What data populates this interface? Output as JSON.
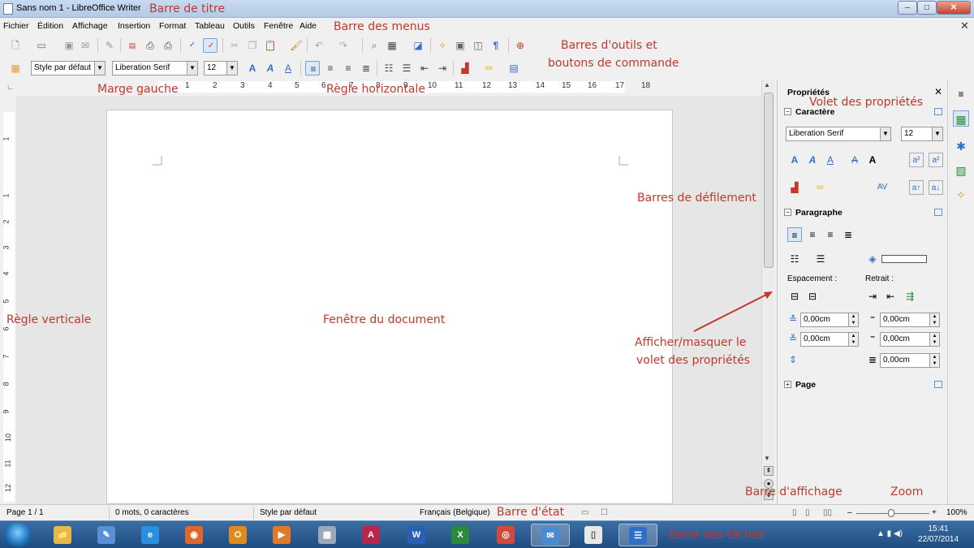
{
  "window": {
    "title": "Sans nom 1 - LibreOffice Writer",
    "min_label": "–",
    "max_label": "□",
    "close_label": "✕"
  },
  "menubar": {
    "items": [
      "Fichier",
      "Édition",
      "Affichage",
      "Insertion",
      "Format",
      "Tableau",
      "Outils",
      "Fenêtre",
      "Aide"
    ],
    "doc_close": "✕"
  },
  "formatting": {
    "style": "Style par défaut",
    "font": "Liberation Serif",
    "size": "12"
  },
  "ruler": {
    "h_numbers": [
      "1",
      "2",
      "3",
      "4",
      "5",
      "6",
      "7",
      "8",
      "9",
      "10",
      "11",
      "12",
      "13",
      "14",
      "15",
      "16",
      "17",
      "18"
    ],
    "v_numbers": [
      "1",
      "1",
      "2",
      "3",
      "4",
      "5",
      "6",
      "7",
      "8",
      "9",
      "10",
      "11",
      "12"
    ]
  },
  "sidebar": {
    "title": "Propriétés",
    "close": "✕",
    "char_section": "Caractère",
    "font": "Liberation Serif",
    "size": "12",
    "para_section": "Paragraphe",
    "spacing_label": "Espacement :",
    "indent_label": "Retrait :",
    "above_value": "0,00cm",
    "below_value": "0,00cm",
    "before_value": "0,00cm",
    "after_value": "0,00cm",
    "first_line_value": "0,00cm",
    "page_section": "Page"
  },
  "statusbar": {
    "page": "Page 1 / 1",
    "words": "0 mots, 0 caractères",
    "style": "Style par défaut",
    "language": "Français (Belgique)",
    "zoom": "100%",
    "zoom_minus": "–",
    "zoom_plus": "+"
  },
  "taskbar": {
    "apps": [
      {
        "icon": "windows-explorer-icon",
        "glyph": "📁",
        "color": "#e8b74a"
      },
      {
        "icon": "tools-icon",
        "glyph": "✎",
        "color": "#5a8fd6"
      },
      {
        "icon": "internet-explorer-icon",
        "glyph": "e",
        "color": "#2a8fe0"
      },
      {
        "icon": "firefox-icon",
        "glyph": "◉",
        "color": "#e0662a"
      },
      {
        "icon": "outlook-icon",
        "glyph": "O",
        "color": "#e08a1e"
      },
      {
        "icon": "media-player-icon",
        "glyph": "▶",
        "color": "#e07a2a"
      },
      {
        "icon": "calculator-icon",
        "glyph": "▦",
        "color": "#9aa8b8"
      },
      {
        "icon": "access-icon",
        "glyph": "A",
        "color": "#b8274a"
      },
      {
        "icon": "word-icon",
        "glyph": "W",
        "color": "#2a5fb8"
      },
      {
        "icon": "excel-icon",
        "glyph": "X",
        "color": "#2a8a3a"
      },
      {
        "icon": "chrome-icon",
        "glyph": "◎",
        "color": "#d44a3a"
      },
      {
        "icon": "thunderbird-icon",
        "glyph": "✉",
        "color": "#4a8ad0"
      },
      {
        "icon": "libreoffice-icon",
        "glyph": "▯",
        "color": "#e8e8e8"
      },
      {
        "icon": "writer-icon",
        "glyph": "☰",
        "color": "#2f6fc8"
      }
    ],
    "time": "15:41",
    "date": "22/07/2014"
  },
  "annotations": {
    "title_bar": "Barre de titre",
    "menu_bar": "Barre des menus",
    "toolbars_1": "Barres d'outils et",
    "toolbars_2": "boutons de commande",
    "left_margin": "Marge gauche",
    "h_ruler": "Règle horizontale",
    "props_pane": "Volet des propriétés",
    "scrollbars": "Barres de défilement",
    "v_ruler": "Règle verticale",
    "doc_window": "Fenêtre du document",
    "toggle_1": "Afficher/masquer le",
    "toggle_2": "volet des propriétés",
    "view_bar": "Barre d'affichage",
    "zoom": "Zoom",
    "status_bar": "Barre d'état",
    "taskbar": "Barre des tâches"
  },
  "colors": {
    "annotation": "#c0392b",
    "accent": "#2f6fc8"
  }
}
